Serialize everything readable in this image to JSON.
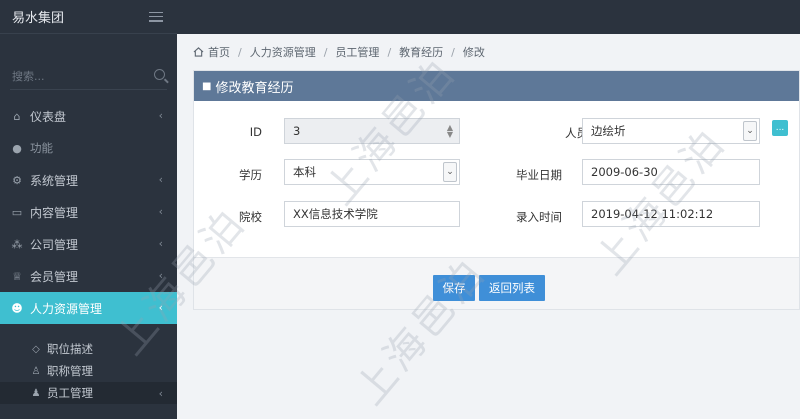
{
  "brand": {
    "name": "易水集团"
  },
  "search": {
    "placeholder": "搜索..."
  },
  "sidebar": {
    "items": [
      {
        "label": "仪表盘",
        "icon": "home-icon"
      },
      {
        "label": "功能",
        "icon": "globe-icon"
      },
      {
        "label": "系统管理",
        "icon": "gears-icon"
      },
      {
        "label": "内容管理",
        "icon": "card-icon"
      },
      {
        "label": "公司管理",
        "icon": "sitemap-icon"
      },
      {
        "label": "会员管理",
        "icon": "trophy-icon"
      },
      {
        "label": "人力资源管理",
        "icon": "users-icon"
      }
    ],
    "subitems": [
      {
        "label": "职位描述",
        "icon": "diamond-icon"
      },
      {
        "label": "职称管理",
        "icon": "user-outline-icon"
      },
      {
        "label": "员工管理",
        "icon": "user-icon"
      }
    ]
  },
  "breadcrumb": [
    "首页",
    "人力资源管理",
    "员工管理",
    "教育经历",
    "修改"
  ],
  "panel": {
    "title": "修改教育经历"
  },
  "form": {
    "id_label": "ID",
    "id_value": "3",
    "person_label": "人员",
    "person_value": "边绘圻",
    "edu_label": "学历",
    "edu_value": "本科",
    "grad_label": "毕业日期",
    "grad_value": "2009-06-30",
    "school_label": "院校",
    "school_value": "XX信息技术学院",
    "entry_label": "录入时间",
    "entry_value": "2019-04-12 11:02:12",
    "pick_label": "..."
  },
  "actions": {
    "save": "保存",
    "back": "返回列表"
  },
  "watermark": "上海邑泊",
  "colors": {
    "accent": "#3fbfd0",
    "panel_header": "#5e7898",
    "button": "#3f8fd8",
    "sidebar": "#2b333e"
  }
}
